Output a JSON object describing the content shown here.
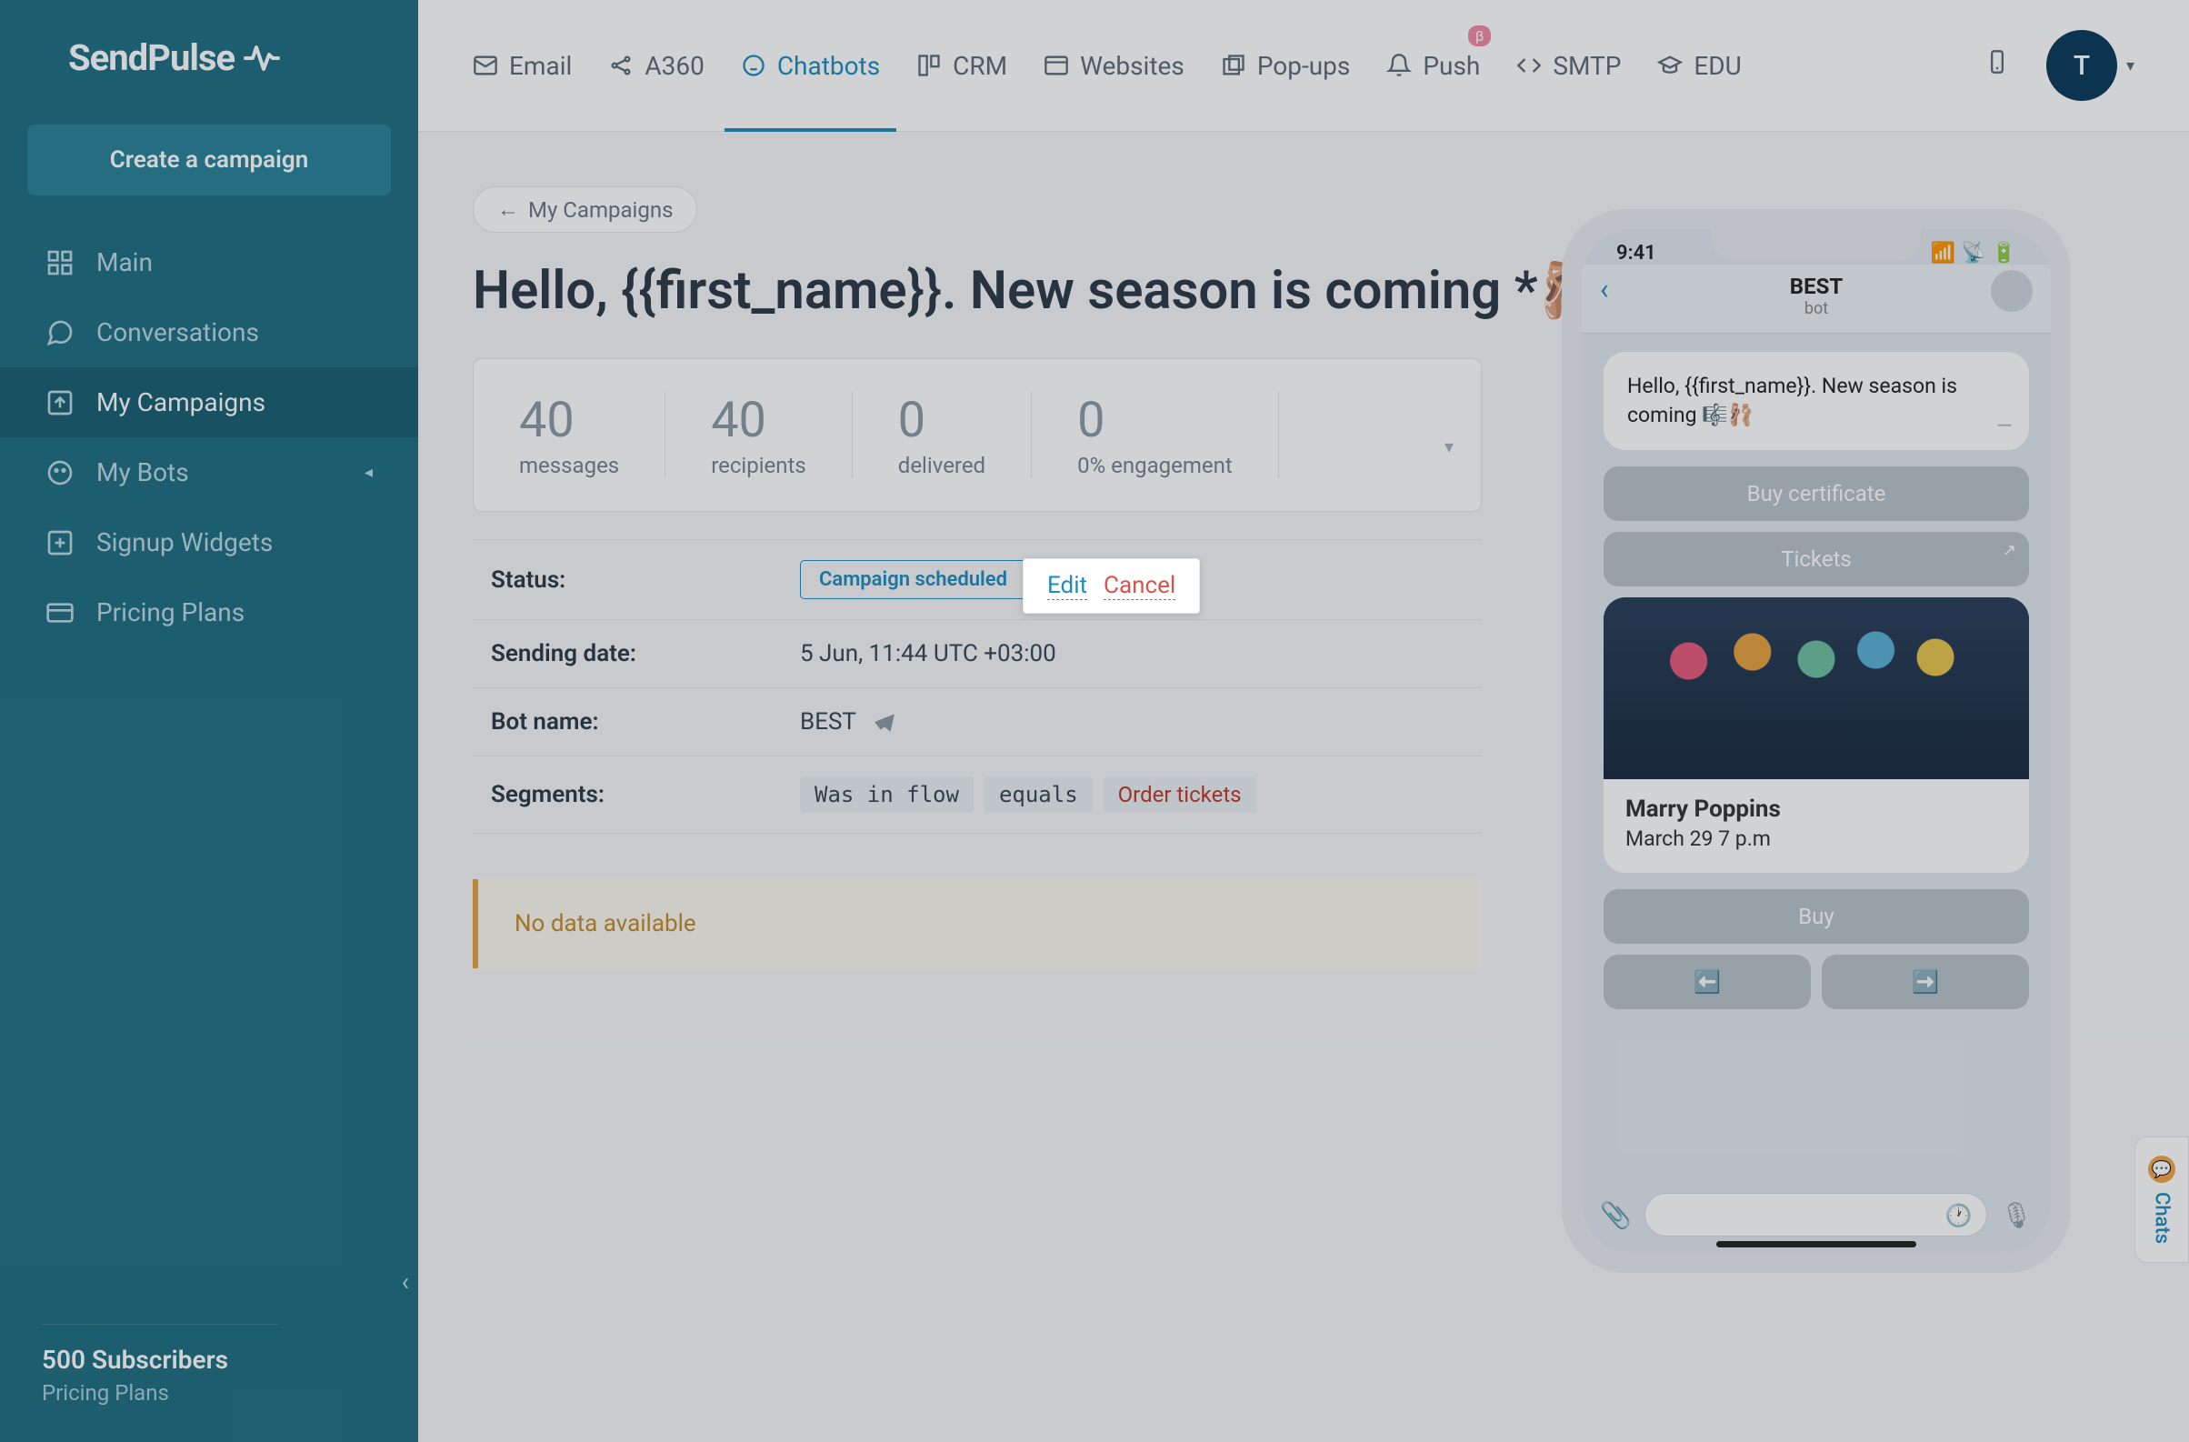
{
  "brand": "SendPulse",
  "sidebar": {
    "create_btn": "Create a campaign",
    "items": [
      {
        "label": "Main"
      },
      {
        "label": "Conversations"
      },
      {
        "label": "My Campaigns"
      },
      {
        "label": "My Bots"
      },
      {
        "label": "Signup Widgets"
      },
      {
        "label": "Pricing Plans"
      }
    ],
    "footer_subs": "500 Subscribers",
    "footer_plan": "Pricing Plans"
  },
  "topnav": {
    "tabs": [
      {
        "label": "Email"
      },
      {
        "label": "A360"
      },
      {
        "label": "Chatbots"
      },
      {
        "label": "CRM"
      },
      {
        "label": "Websites"
      },
      {
        "label": "Pop-ups"
      },
      {
        "label": "Push",
        "badge": "β"
      },
      {
        "label": "SMTP"
      },
      {
        "label": "EDU"
      }
    ],
    "user_initial": "T"
  },
  "breadcrumb": "My Campaigns",
  "page_title": "Hello, {{first_name}}. New season is coming *🩰",
  "stats": [
    {
      "num": "40",
      "label": "messages"
    },
    {
      "num": "40",
      "label": "recipients"
    },
    {
      "num": "0",
      "label": "delivered"
    },
    {
      "num": "0",
      "label": "0% engagement"
    }
  ],
  "details": {
    "status_k": "Status:",
    "status_badge": "Campaign scheduled",
    "edit": "Edit",
    "cancel": "Cancel",
    "date_k": "Sending date:",
    "date_v": "5 Jun, 11:44 UTC +03:00",
    "bot_k": "Bot name:",
    "bot_v": "BEST",
    "seg_k": "Segments:",
    "seg_field": "Was in flow",
    "seg_op": "equals",
    "seg_val": "Order tickets"
  },
  "nodata": "No data available",
  "phone": {
    "time": "9:41",
    "title": "BEST",
    "sub": "bot",
    "msg": "Hello, {{first_name}}. New season is coming 🎼🩰",
    "btn1": "Buy certificate",
    "btn2": "Tickets",
    "card_title": "Marry Poppins",
    "card_date": "March 29 7 p.m",
    "btn3": "Buy",
    "arrow_l": "⬅️",
    "arrow_r": "➡️"
  },
  "chats_tab": "Chats",
  "chats_badge": "💬"
}
